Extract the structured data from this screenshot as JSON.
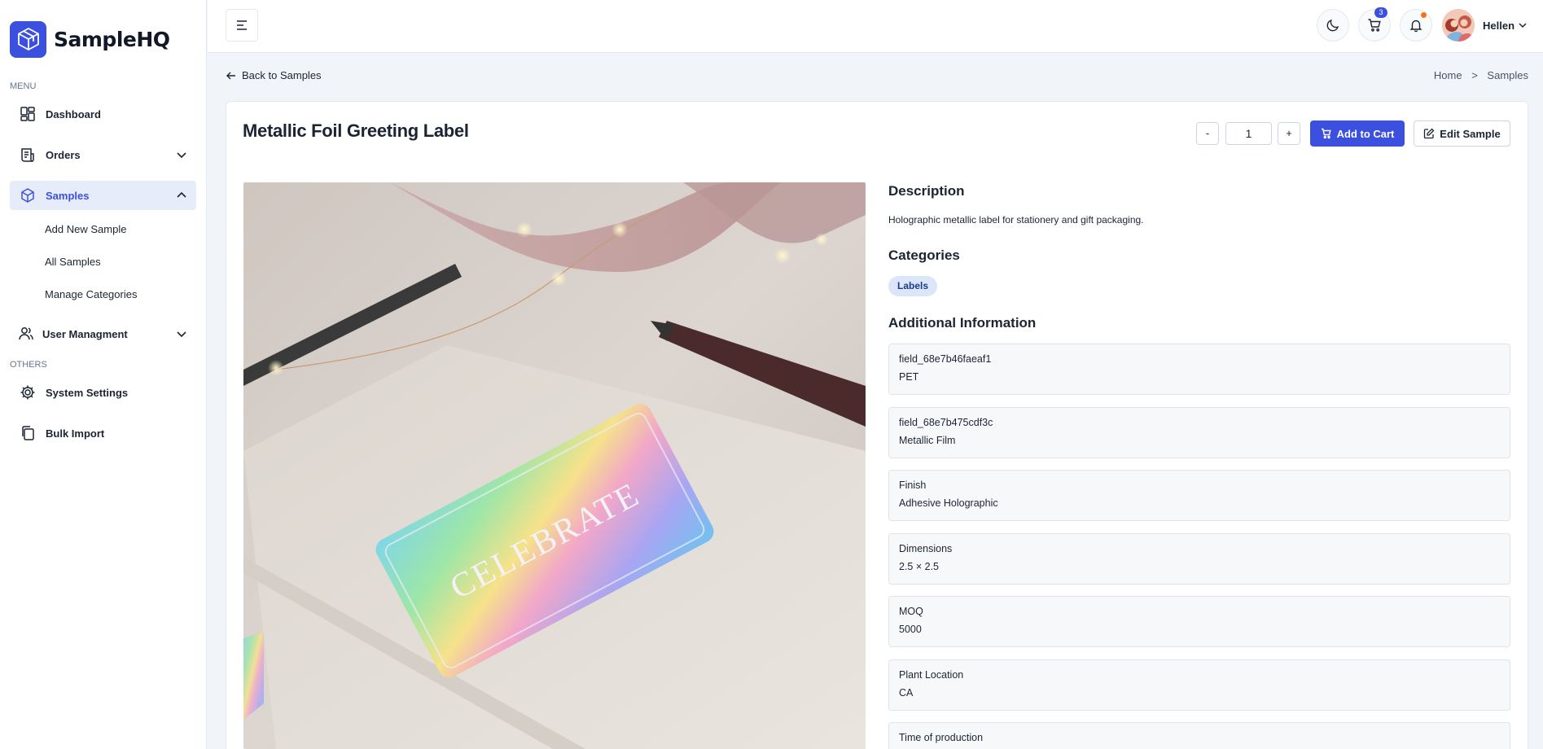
{
  "brand": {
    "name": "SampleHQ"
  },
  "sidebar": {
    "menu_label": "MENU",
    "others_label": "OTHERS",
    "items": [
      {
        "label": "Dashboard",
        "icon": "grid-icon"
      },
      {
        "label": "Orders",
        "icon": "receipt-icon"
      },
      {
        "label": "Samples",
        "icon": "box-icon",
        "active": true
      },
      {
        "label": "User Managment",
        "icon": "users-icon"
      },
      {
        "label": "System Settings",
        "icon": "gear-icon"
      },
      {
        "label": "Bulk Import",
        "icon": "copy-icon"
      }
    ],
    "sub_items": [
      "Add New Sample",
      "All Samples",
      "Manage Categories"
    ]
  },
  "header": {
    "cart_count": "3",
    "user_name": "Hellen"
  },
  "page": {
    "back_label": "Back to Samples",
    "breadcrumb": [
      "Home",
      "Samples"
    ],
    "breadcrumb_sep": ">",
    "title": "Metallic Foil Greeting Label",
    "qty_minus": "-",
    "qty_plus": "+",
    "qty_value": "1",
    "add_to_cart_label": "Add to Cart",
    "edit_label": "Edit Sample",
    "image_text": "CELEBRATE"
  },
  "details": {
    "description_heading": "Description",
    "description": "Holographic metallic label for stationery and gift packaging.",
    "categories_heading": "Categories",
    "categories": [
      "Labels"
    ],
    "additional_heading": "Additional Information",
    "fields": [
      {
        "label": "field_68e7b46faeaf1",
        "value": "PET"
      },
      {
        "label": "field_68e7b475cdf3c",
        "value": "Metallic Film"
      },
      {
        "label": "Finish",
        "value": "Adhesive Holographic"
      },
      {
        "label": "Dimensions",
        "value": "2.5 × 2.5"
      },
      {
        "label": "MOQ",
        "value": "5000"
      },
      {
        "label": "Plant Location",
        "value": "CA"
      },
      {
        "label": "Time of production",
        "value": ""
      }
    ]
  },
  "colors": {
    "accent": "#3c50e0",
    "tag_bg": "#dbe6fb",
    "notif": "#f97316"
  }
}
